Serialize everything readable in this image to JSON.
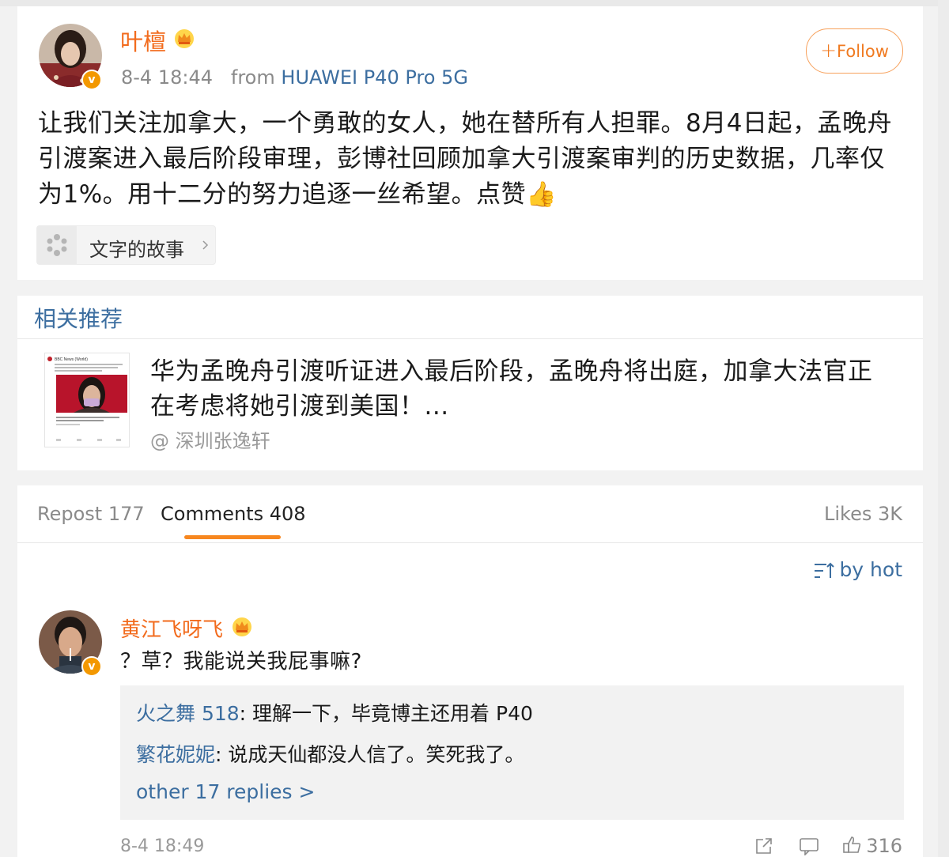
{
  "post": {
    "author": "叶檀",
    "time": "8-4 18:44",
    "from_label": "from",
    "source": "HUAWEI P40 Pro 5G",
    "follow_label": "Follow",
    "text": "让我们关注加拿大，一个勇敢的女人，她在替所有人担罪。8月4日起，孟晚舟引渡案进入最后阶段审理，彭博社回顾加拿大引渡案审判的历史数据，几率仅为1%。用十二分的努力追逐一丝希望。点赞👍",
    "topic": "文字的故事",
    "icons": [
      "verified-badge",
      "crown-badge",
      "topic-spinner-icon",
      "chevron-right-icon"
    ]
  },
  "related": {
    "section_title": "相关推荐",
    "headline": "华为孟晚舟引渡听证进入最后阶段，孟晚舟将出庭，加拿大法官正在考虑将她引渡到美国！...",
    "author": "@ 深圳张逸轩",
    "thumbnail": {
      "account": "BBC News (World)",
      "headline": "Huawei's chief financial officer Meng Wanzhou due in court as Canadian judge weighs her extradition to the US",
      "caption": "Meng Wanzhou: Final arguments in extradition battle",
      "domain": "bbc.com"
    }
  },
  "comments": {
    "tabs": {
      "repost": "Repost 177",
      "comments": "Comments 408",
      "likes": "Likes 3K"
    },
    "sort_label": "by hot",
    "items": [
      {
        "user": "黄江飞呀飞",
        "text": "？草？我能说关我屁事嘛?",
        "replies": [
          {
            "user": "火之舞 518",
            "text": "理解一下，毕竟博主还用着 P40"
          },
          {
            "user": "繁花妮妮",
            "text": "说成天仙都没人信了。笑死我了。"
          }
        ],
        "more_replies": "other 17 replies >",
        "time": "8-4 18:49",
        "likes": "316"
      }
    ],
    "icons": [
      "sort-icon",
      "share-icon",
      "comment-icon",
      "like-icon"
    ]
  },
  "colors": {
    "name_orange": "#f26b1d",
    "link_blue": "#3c6ea0",
    "accent_orange": "#f7871f",
    "gray_text": "#8a8a8a"
  }
}
